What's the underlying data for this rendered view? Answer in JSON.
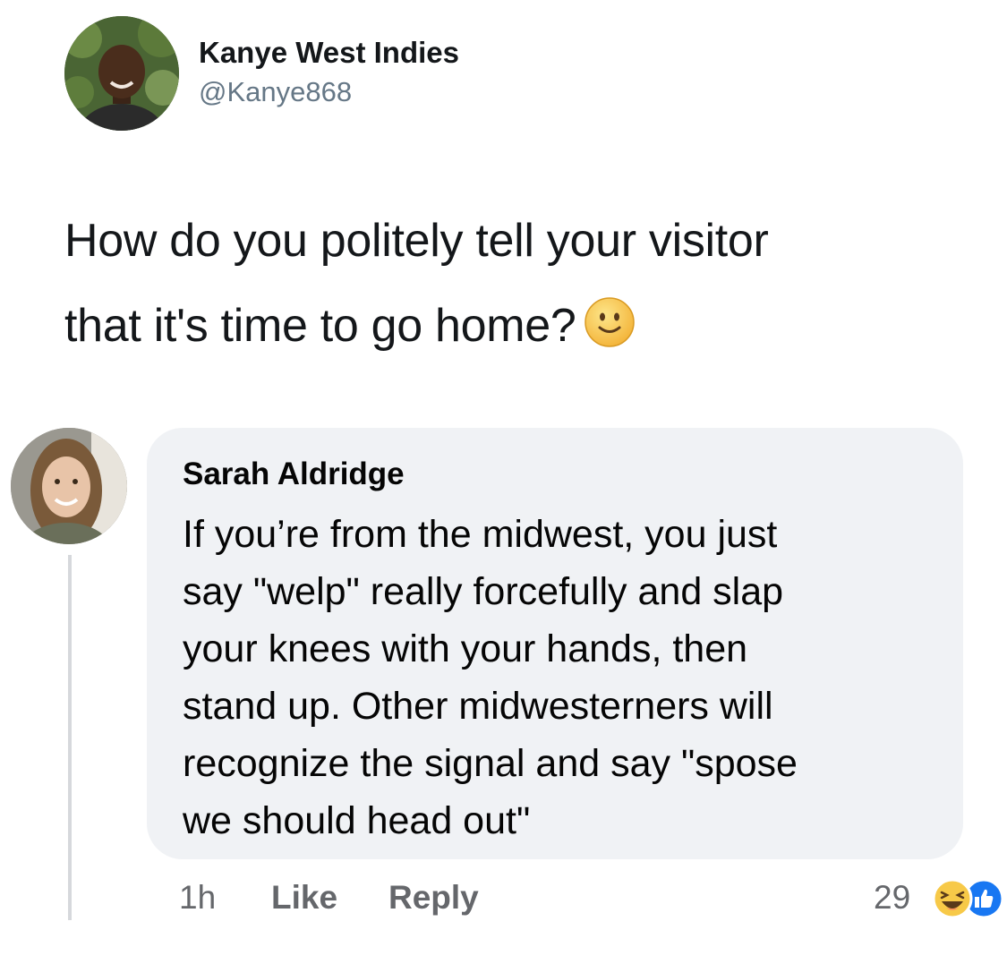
{
  "tweet": {
    "author_name": "Kanye West Indies",
    "author_handle": "@Kanye868",
    "text_lines": [
      "How do you politely tell your visitor",
      "that it's time to go home?"
    ],
    "emoji": "slightly-smiling-face-icon"
  },
  "comment": {
    "author_name": "Sarah Aldridge",
    "text_lines": [
      "If you’re from the midwest, you just",
      "say \"welp\" really forcefully and slap",
      "your knees with your hands, then",
      "stand up. Other midwesterners will",
      "recognize the signal and say \"spose",
      "we should head out\""
    ],
    "time": "1h",
    "like_label": "Like",
    "reply_label": "Reply",
    "reaction_count": "29",
    "reaction_icons": [
      "haha-icon",
      "like-icon"
    ]
  },
  "colors": {
    "bubble_background": "#f0f2f5",
    "meta_text": "#65676b",
    "handle_text": "#657786",
    "like_blue": "#1877f2",
    "emoji_yellow": "#f7c948"
  }
}
